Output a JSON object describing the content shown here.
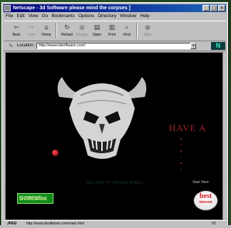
{
  "window": {
    "title": "Netscape - 3d Software   please mind the corpses ]"
  },
  "menu": [
    "File",
    "Edit",
    "View",
    "Go",
    "Bookmarks",
    "Options",
    "Directory",
    "Window",
    "Help"
  ],
  "toolbar": [
    {
      "label": "Back",
      "icon": "back-arrow-icon",
      "glyph": "⇦"
    },
    {
      "label": "Fwd",
      "icon": "forward-arrow-icon",
      "glyph": "⇨"
    },
    {
      "label": "Home",
      "icon": "home-icon",
      "glyph": "⌂"
    },
    {
      "label": "Reload",
      "icon": "reload-icon",
      "glyph": "↻"
    },
    {
      "label": "Images",
      "icon": "images-icon",
      "glyph": "▣"
    },
    {
      "label": "Open",
      "icon": "open-icon",
      "glyph": "▤"
    },
    {
      "label": "Print",
      "icon": "print-icon",
      "glyph": "▥"
    },
    {
      "label": "Find",
      "icon": "find-icon",
      "glyph": "⌕"
    },
    {
      "label": "Stop",
      "icon": "stop-icon",
      "glyph": "●"
    }
  ],
  "location": {
    "label": "Location:",
    "url": "http://www.idsoftware.com/"
  },
  "content": {
    "headline": "HAVE A",
    "tagline": "WELCOME TO THE REAL WORLD",
    "start_label": "Start Here",
    "badge_software": {
      "top": "We swapped with",
      "main": "SHAREWARE"
    },
    "badge_best": {
      "main": "best",
      "sub": "internet"
    }
  },
  "status": {
    "left": "JPEG",
    "url": "http://www.idsoftware.com/main.html",
    "right": "52"
  },
  "colors": {
    "accent": "#a0202a",
    "title_bar": "#00007b",
    "window_bg": "#c0c0c0"
  }
}
